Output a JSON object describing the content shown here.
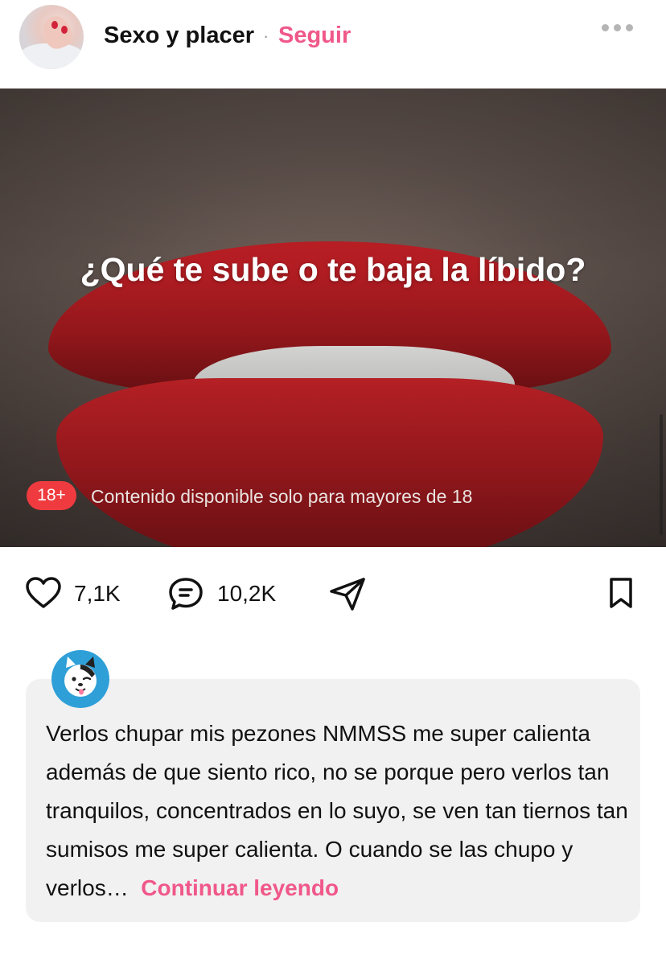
{
  "header": {
    "author": "Sexo y placer",
    "separator": "·",
    "follow_label": "Seguir",
    "more_icon": "more-horizontal-icon"
  },
  "post": {
    "title": "¿Qué te sube o te baja la líbido?",
    "age_badge": "18+",
    "age_notice": "Contenido disponible solo para mayores de 18"
  },
  "actions": {
    "like_icon": "heart-icon",
    "likes": "7,1K",
    "comment_icon": "comment-icon",
    "comments": "10,2K",
    "share_icon": "send-icon",
    "save_icon": "bookmark-icon"
  },
  "comment": {
    "avatar_icon": "dog-avatar-icon",
    "text": "Verlos chupar mis pezones NMMSS  me super calienta además de que siento rico, no se porque pero verlos tan tranquilos, concentrados en lo suyo, se ven tan tiernos tan sumisos me super calienta. O cuando se las chupo y verlos…",
    "more_label": "Continuar leyendo"
  },
  "colors": {
    "accent": "#f0588a",
    "badge": "#ef3b3f",
    "card_bg": "#f1f1f1",
    "avatar_bg": "#2f9fd8"
  }
}
